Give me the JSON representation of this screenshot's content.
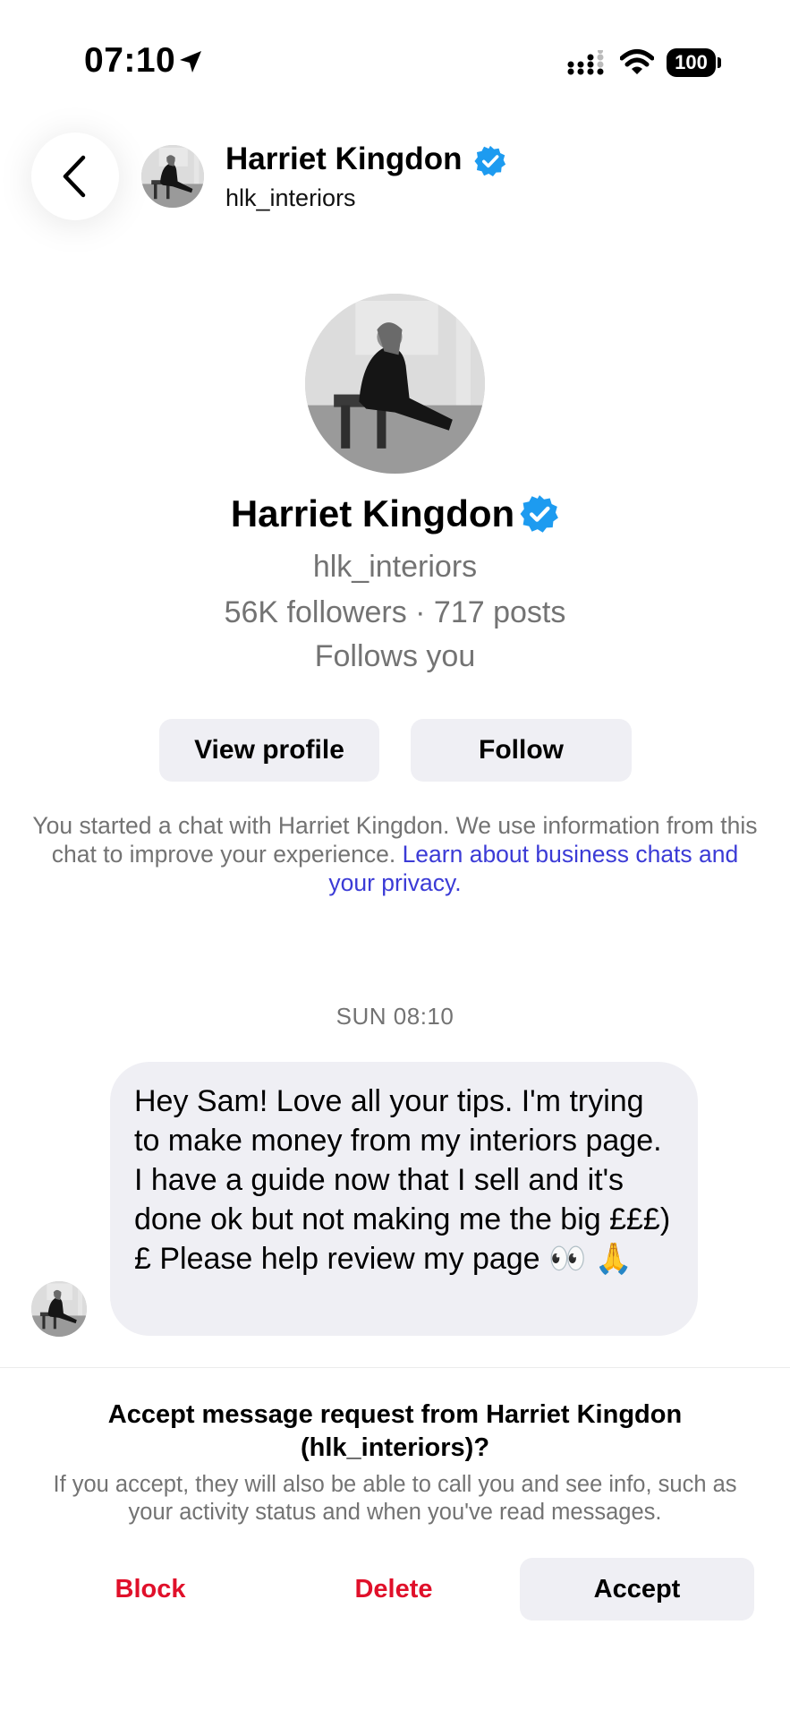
{
  "status_bar": {
    "time": "07:10",
    "battery": "100"
  },
  "header": {
    "name": "Harriet Kingdon",
    "username": "hlk_interiors"
  },
  "profile": {
    "name": "Harriet Kingdon",
    "username": "hlk_interiors",
    "stats": "56K followers · 717 posts",
    "relationship": "Follows you",
    "view_profile_label": "View profile",
    "follow_label": "Follow"
  },
  "notice": {
    "text": "You started a chat with Harriet Kingdon. We use information from this chat to improve your experience. ",
    "link": "Learn about business chats and your privacy",
    "end": "."
  },
  "chat": {
    "timestamp": "SUN 08:10",
    "message": "Hey Sam! Love all your tips. I'm trying to make money from my interiors page. I have a guide now that I sell and it's done ok but not making me the big £££)£ Please help review my page 👀 🙏"
  },
  "request": {
    "title": "Accept message request from Harriet Kingdon (hlk_interiors)?",
    "description": "If you accept, they will also be able to call you and see info, such as your activity status and when you've read messages.",
    "block_label": "Block",
    "delete_label": "Delete",
    "accept_label": "Accept"
  },
  "colors": {
    "link": "#3b3bd6",
    "danger": "#e0102a",
    "verified": "#1d9bf0",
    "button_bg": "#efeff4"
  }
}
